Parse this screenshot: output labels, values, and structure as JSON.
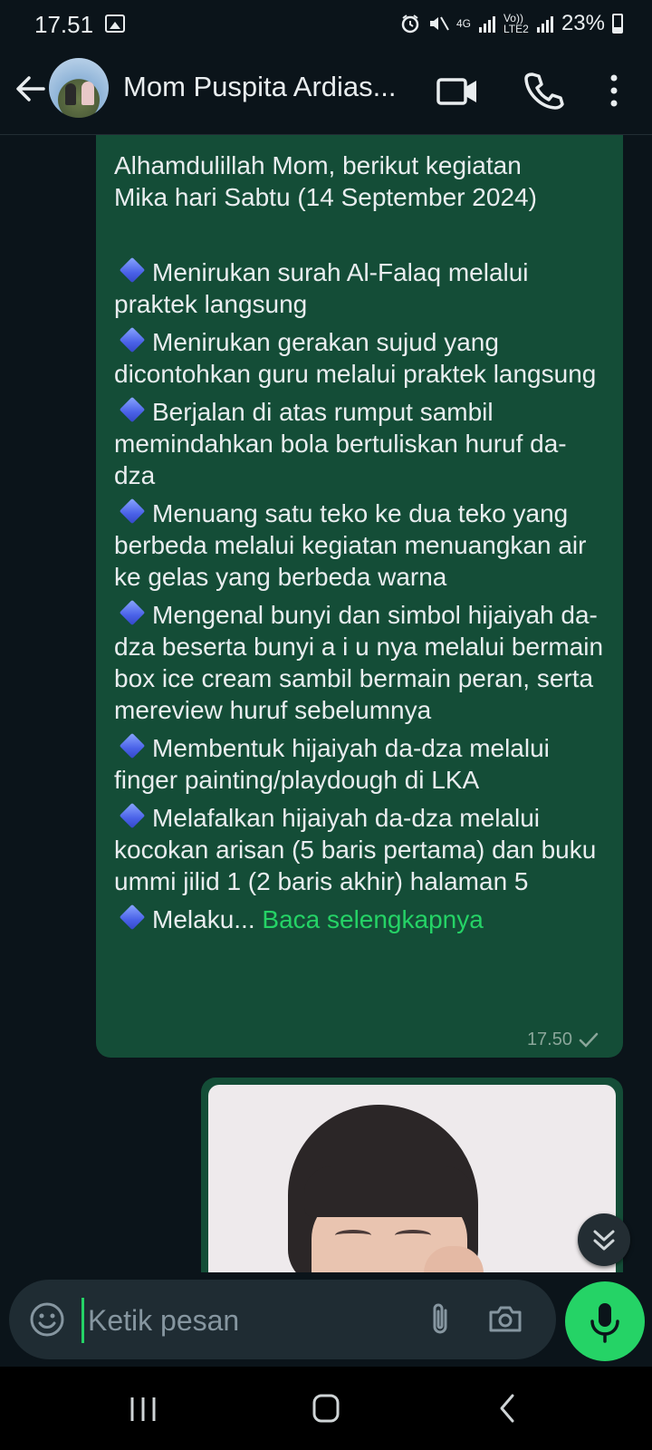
{
  "status_bar": {
    "time": "17.51",
    "network_small": "4G",
    "volte": "Vo)) LTE2",
    "battery": "23%"
  },
  "header": {
    "contact_name": "Mom Puspita Ardias..."
  },
  "message": {
    "intro_1": "Alhamdulillah Mom, berikut kegiatan",
    "intro_2": "Mika hari Sabtu (14 September 2024)",
    "items": [
      "Menirukan surah Al-Falaq melalui praktek langsung",
      "Menirukan gerakan sujud yang dicontohkan guru melalui praktek langsung",
      "Berjalan di atas rumput sambil memindahkan bola bertuliskan huruf da-dza",
      "Menuang satu teko ke dua teko yang berbeda melalui kegiatan menuangkan air ke gelas yang berbeda warna",
      "Mengenal bunyi dan simbol hijaiyah da-dza beserta bunyi a i u nya melalui bermain box ice cream sambil bermain peran, serta mereview huruf sebelumnya",
      "Membentuk hijaiyah da-dza melalui finger painting/playdough di LKA",
      "Melafalkan hijaiyah da-dza melalui kocokan arisan (5 baris pertama) dan buku ummi jilid 1 (2 baris akhir) halaman 5"
    ],
    "truncated_item": "Melaku...",
    "read_more": "Baca selengkapnya",
    "time": "17.50",
    "status": "sent",
    "emoji_bullet": "blue-diamond"
  },
  "input": {
    "placeholder": "Ketik pesan"
  },
  "colors": {
    "background": "#0b141a",
    "outgoing_bubble": "#144d37",
    "accent": "#25d366",
    "input_bg": "#1f2c33"
  }
}
